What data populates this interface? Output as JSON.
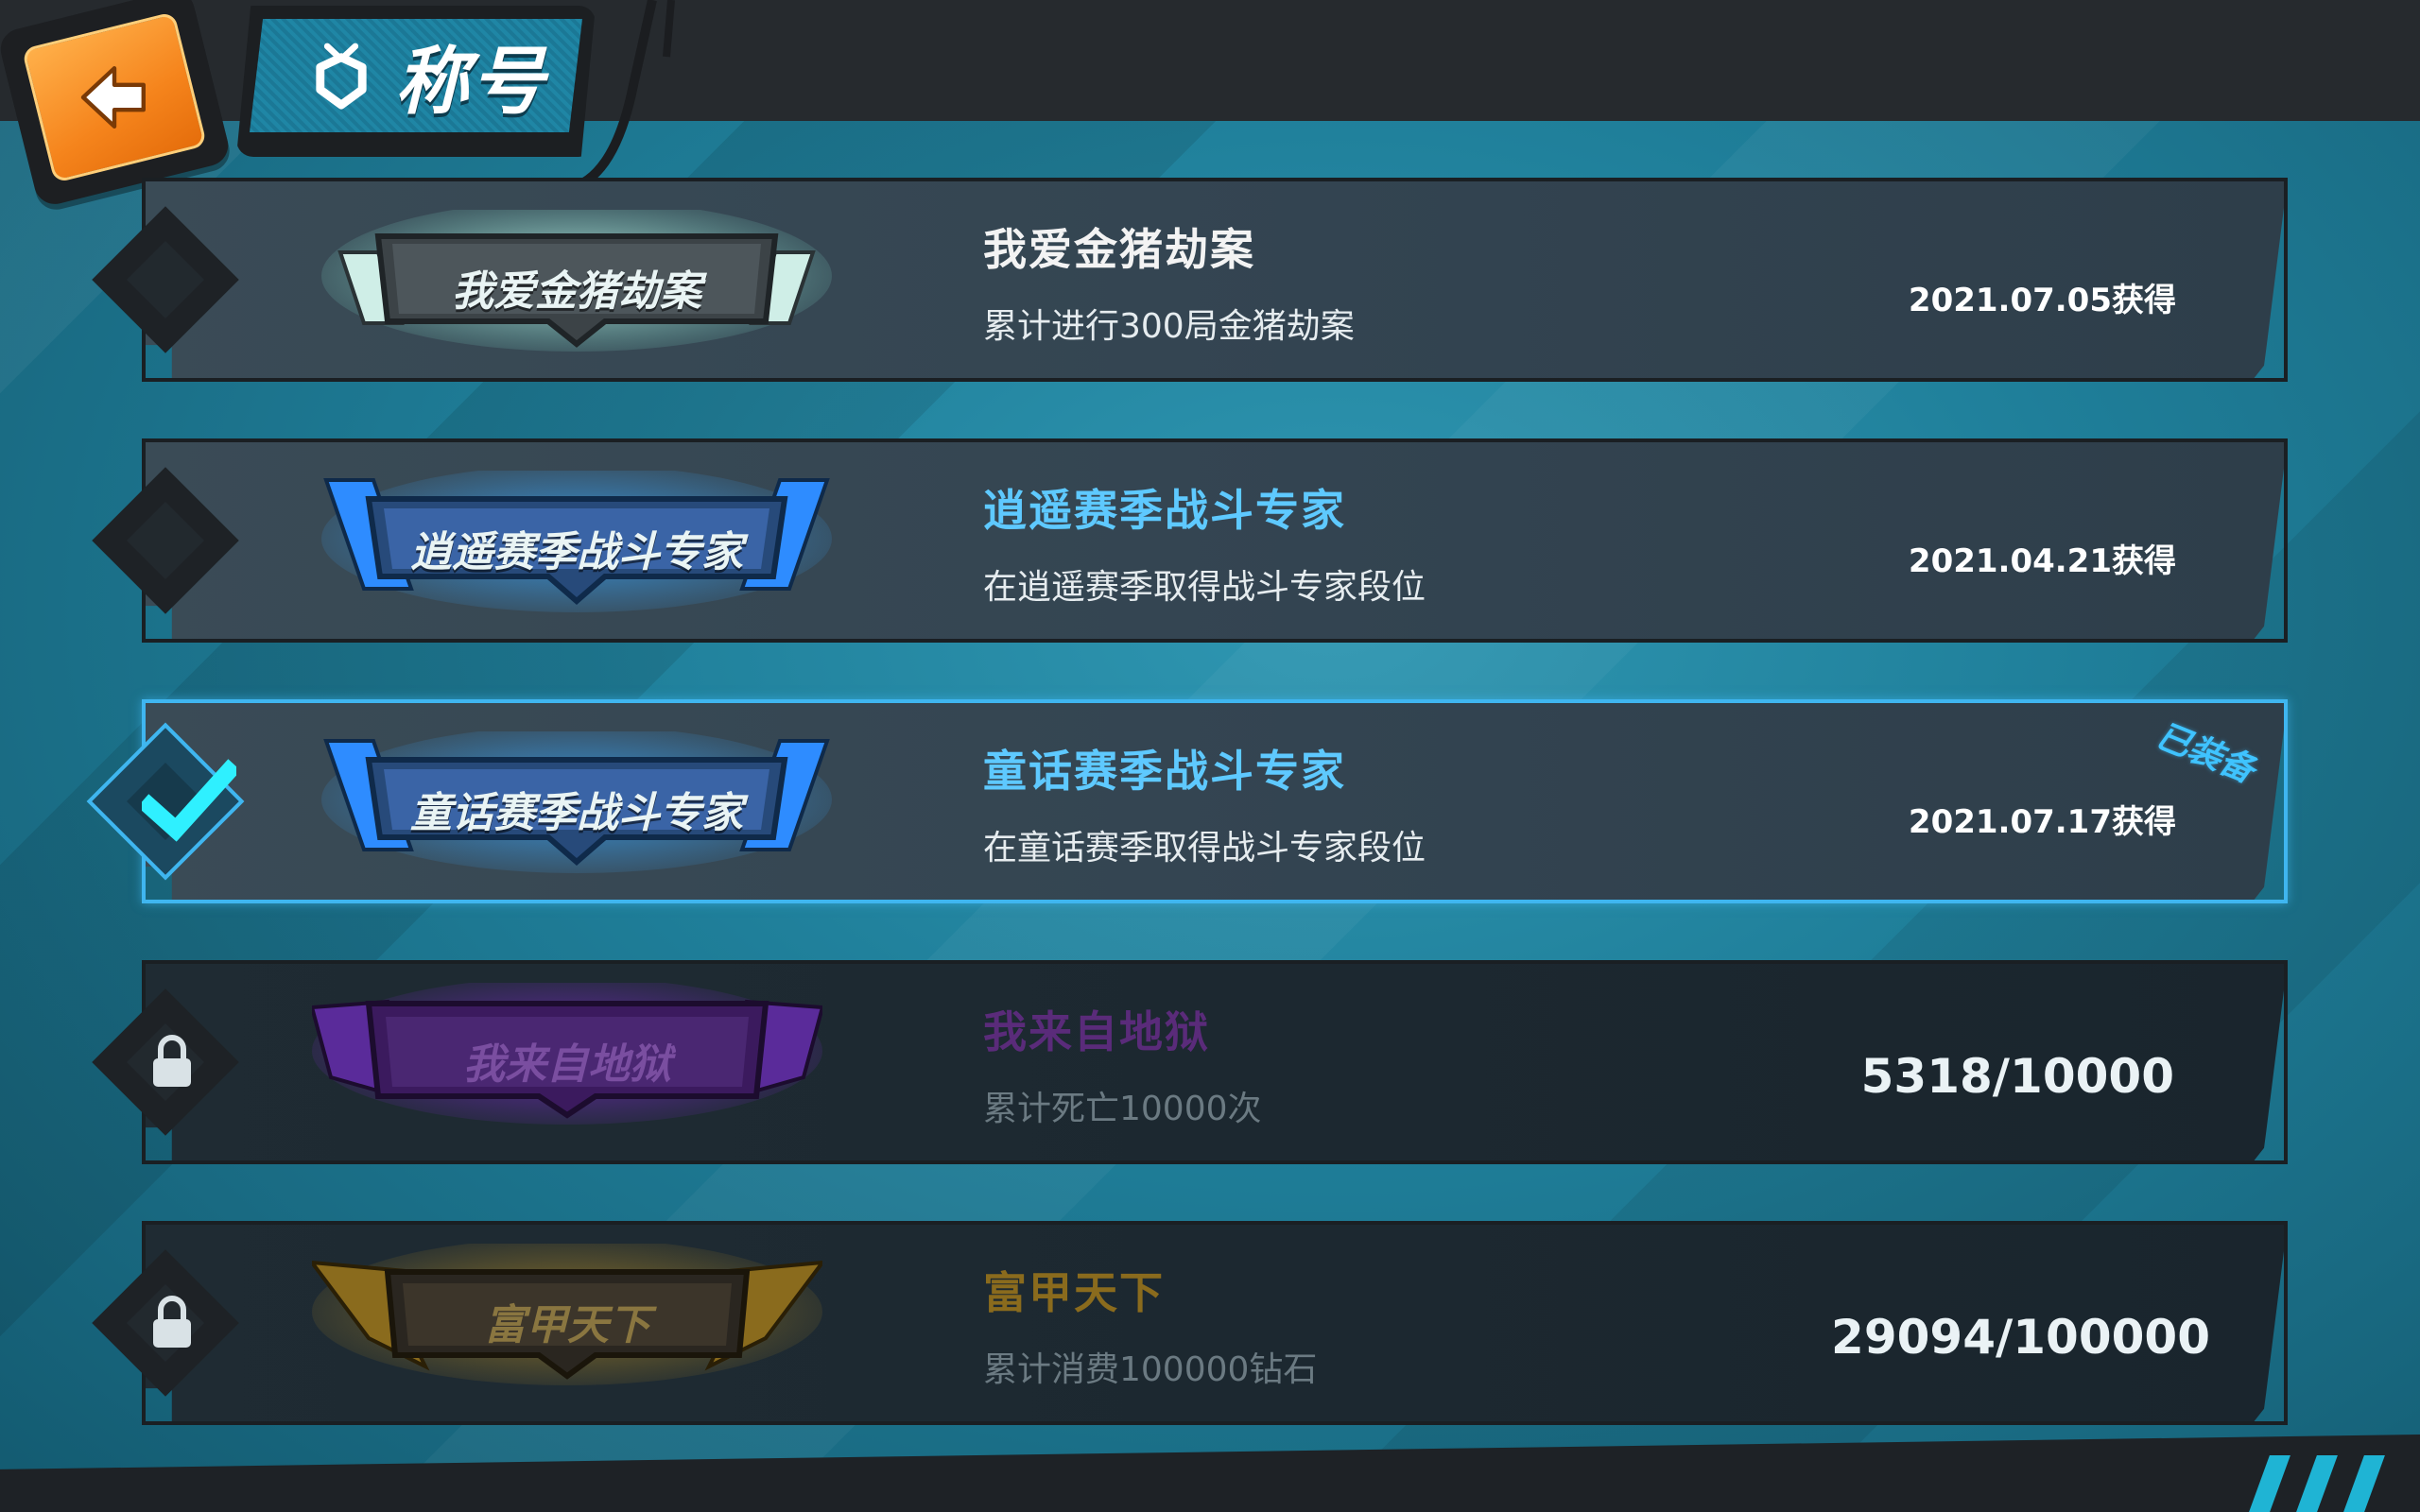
{
  "header": {
    "title": "称号",
    "back_icon": "back-arrow-icon",
    "title_icon": "title-badge-icon"
  },
  "colors": {
    "accent_blue": "#3fb6f0",
    "back_orange": "#f5841c",
    "name_white": "#f3f3f3",
    "name_blue": "#5ec9ff",
    "name_purple": "#5a2b7a",
    "name_gold": "#8a6b1d"
  },
  "titles": [
    {
      "badge_label": "我爱金猪劫案",
      "name": "我爱金猪劫案",
      "description": "累计进行300局金猪劫案",
      "obtained": "2021.07.05获得",
      "status": "unlocked"
    },
    {
      "badge_label": "逍遥赛季战斗专家",
      "name": "逍遥赛季战斗专家",
      "description": "在逍遥赛季取得战斗专家段位",
      "obtained": "2021.04.21获得",
      "status": "unlocked"
    },
    {
      "badge_label": "童话赛季战斗专家",
      "name": "童话赛季战斗专家",
      "description": "在童话赛季取得战斗专家段位",
      "obtained": "2021.07.17获得",
      "status": "equipped",
      "equipped_label": "已装备"
    },
    {
      "badge_label": "我来自地狱",
      "name": "我来自地狱",
      "description": "累计死亡10000次",
      "progress_text": "5318/10000",
      "progress": 0.5318,
      "status": "locked"
    },
    {
      "badge_label": "富甲天下",
      "name": "富甲天下",
      "description": "累计消费100000钻石",
      "progress_text": "29094/100000",
      "progress": 0.29094,
      "status": "locked"
    }
  ]
}
